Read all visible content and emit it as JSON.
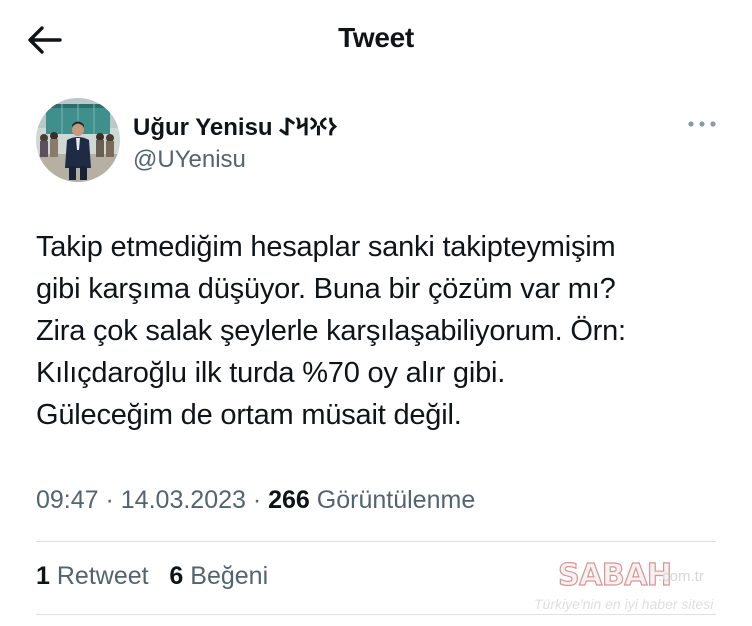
{
  "header": {
    "title": "Tweet",
    "back_icon": "back-arrow-icon"
  },
  "author": {
    "name": "Uğur Yenisu 𐰆𐰍𐰺𐰀",
    "handle": "@UYenisu",
    "more_icon": "more-horizontal-icon"
  },
  "tweet": {
    "lines": [
      "Takip etmediğim hesaplar sanki takipteymişim",
      "gibi karşıma düşüyor. Buna bir çözüm var mı?",
      "Zira çok salak şeylerle karşılaşabiliyorum. Örn:",
      "Kılıçdaroğlu ilk turda %70 oy alır gibi.",
      "Güleceğim de ortam müsait değil."
    ]
  },
  "meta": {
    "time": "09:47",
    "separator": " · ",
    "date": "14.03.2023",
    "views_count": "266",
    "views_label": "Görüntülenme"
  },
  "stats": {
    "retweets_count": "1",
    "retweets_label": "Retweet",
    "likes_count": "6",
    "likes_label": "Beğeni"
  },
  "watermark": {
    "logo": "SABAH",
    "domain": ".com.tr",
    "tagline": "Türkiye'nin en iyi haber sitesi"
  },
  "colors": {
    "text": "#0f1419",
    "secondary": "#536471",
    "divider": "#dbe1e5",
    "watermark_red": "#c23b3b"
  }
}
